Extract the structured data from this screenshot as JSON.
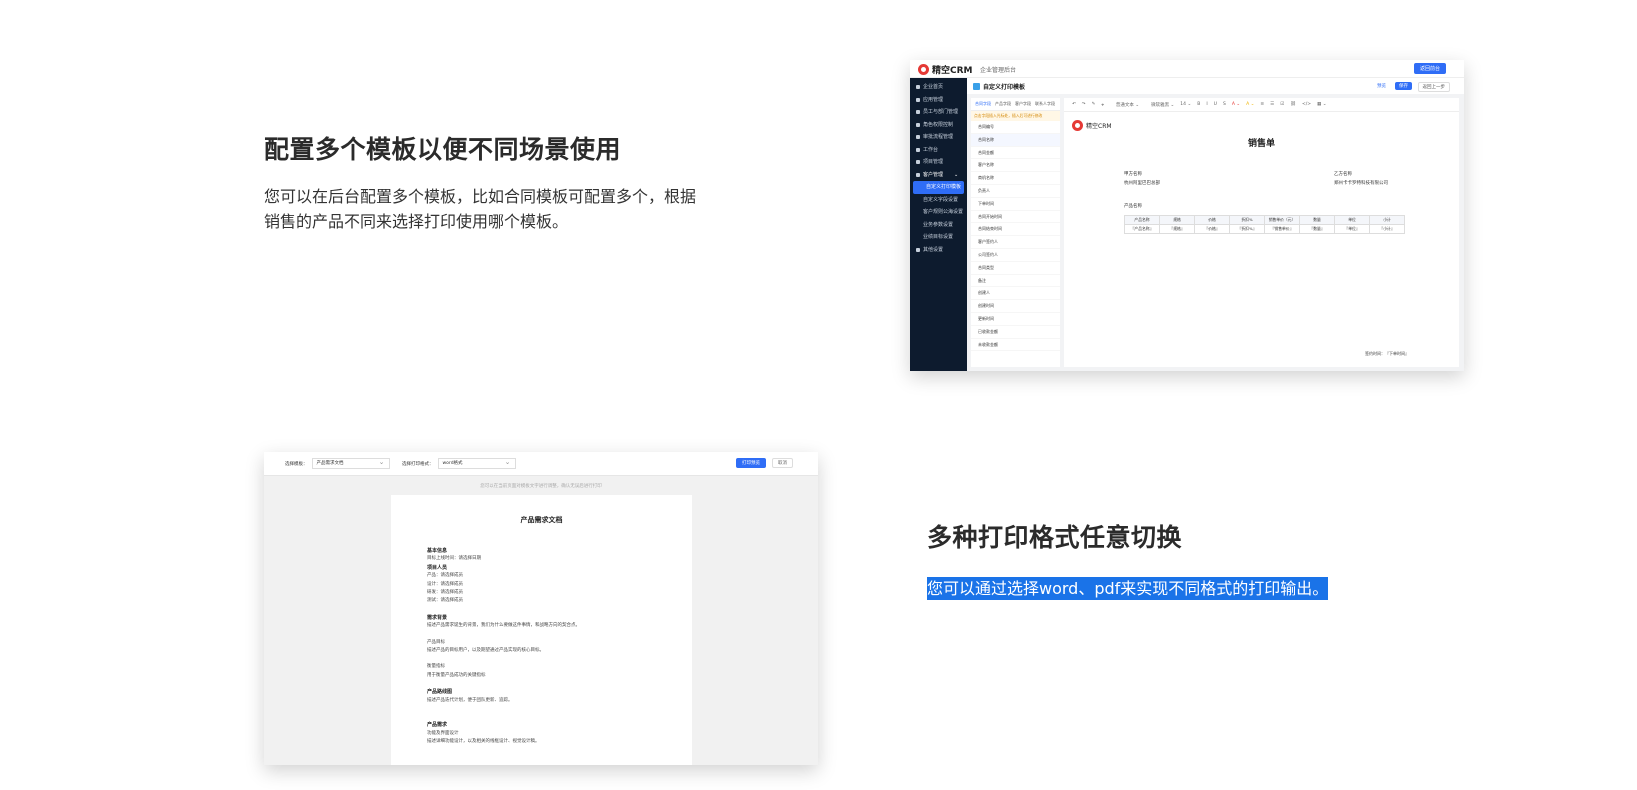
{
  "feature1": {
    "title": "配置多个模板以便不同场景使用",
    "line1": "您可以在后台配置多个模板，比如合同模板可配置多个，根据",
    "line2": "销售的产品不同来选择打印使用哪个模板。"
  },
  "feature2": {
    "title": "多种打印格式任意切换",
    "desc": "您可以通过选择word、pdf来实现不同格式的打印输出。"
  },
  "crm": {
    "brand": "精空CRM",
    "breadcrumb": "企业管理后台",
    "top_button": "返回前台",
    "sidebar": [
      {
        "label": "企业首页"
      },
      {
        "label": "应用管理"
      },
      {
        "label": "员工与部门管理"
      },
      {
        "label": "角色权限控制"
      },
      {
        "label": "审批流程管理"
      },
      {
        "label": "工作台"
      },
      {
        "label": "项目管理"
      },
      {
        "label": "客户管理"
      },
      {
        "label": "自定义打印模板"
      },
      {
        "label": "自定义字段设置"
      },
      {
        "label": "客户规则公海设置"
      },
      {
        "label": "业务参数设置"
      },
      {
        "label": "业绩目标设置"
      },
      {
        "label": "其他设置"
      }
    ],
    "header_title": "自定义打印模板",
    "header_buttons": {
      "b1": "预览",
      "b2": "保存",
      "b3": "返回上一步"
    },
    "field_tabs": [
      "合同字段",
      "产品字段",
      "客户字段",
      "联系人字段"
    ],
    "field_warning": "点击字段插入光标处，插入后可进行修改",
    "fields": [
      "合同编号",
      "合同名称",
      "合同金额",
      "客户名称",
      "商机名称",
      "负责人",
      "下单时间",
      "合同开始时间",
      "合同结束时间",
      "客户签约人",
      "公司签约人",
      "合同类型",
      "备注",
      "创建人",
      "创建时间",
      "更新时间",
      "已收款金额",
      "未收款金额"
    ],
    "toolbar": [
      "↶",
      "↷",
      "✎",
      "⌖",
      "普通文本 ⌄",
      "微软雅黑 ⌄",
      "14 ⌄",
      "B",
      "I",
      "U",
      "S",
      "A ⌄",
      "A ⌄",
      "≡",
      "☰",
      "☑",
      "⛓",
      "</>",
      "▦ ⌄"
    ],
    "doc": {
      "logo_text": "精空CRM",
      "title": "销售单",
      "party_a_label": "甲方名称",
      "party_a": "杭州阿里巴巴总部",
      "party_b_label": "乙方名称",
      "party_b": "郑州卡卡罗特科技有限公司",
      "product_label": "产品名称",
      "table_header": [
        "产品名称",
        "规格",
        "价格",
        "折扣%",
        "销售单价（元）",
        "数量",
        "单位",
        "小计"
      ],
      "table_row": [
        "『产品名称』",
        "『规格』",
        "『价格』",
        "『折扣%』",
        "『销售单价』",
        "『数量』",
        "『单位』",
        "『小计』"
      ],
      "sign": "签约时间：『下单时间』"
    }
  },
  "preview": {
    "label1": "选择模板：",
    "value1": "产品需求文档",
    "label2": "选择打印格式：",
    "value2": "word格式",
    "print_button": "打印预览",
    "cancel_button": "取消",
    "hint": "您可以在当前页面对模板文字进行调整，确认无误后进行打印",
    "doc_title": "产品需求文档",
    "lines": [
      {
        "t": "基本信息",
        "b": true
      },
      {
        "t": "目标上线时间：请选择日期"
      },
      {
        "t": "项目人员",
        "b": true
      },
      {
        "t": "产品：请选择成员"
      },
      {
        "t": "设计：请选择成员"
      },
      {
        "t": "研发：请选择成员"
      },
      {
        "t": "测试：请选择成员"
      },
      {
        "gap": true
      },
      {
        "t": "需求背景",
        "b": true
      },
      {
        "t": "描述产品需求诞生的背景，我们为什么要做这件事情，和战略方向的契合点。"
      },
      {
        "gap": true
      },
      {
        "t": "产品目标"
      },
      {
        "t": "描述产品的目标用户，以及期望通过产品实现的核心目标。"
      },
      {
        "gap": true
      },
      {
        "t": "衡量指标"
      },
      {
        "t": "用于衡量产品成功的关键指标"
      },
      {
        "gap": true
      },
      {
        "t": "产品路线图",
        "b": true
      },
      {
        "t": "描述产品迭代计划，便于团队更新、追踪。"
      },
      {
        "gap": true
      },
      {
        "gap": true
      },
      {
        "t": "产品需求",
        "b": true
      },
      {
        "t": "功能及界面设计"
      },
      {
        "t": "描述详细功能设计，以及相关的线框设计、视觉设计稿。"
      }
    ]
  }
}
